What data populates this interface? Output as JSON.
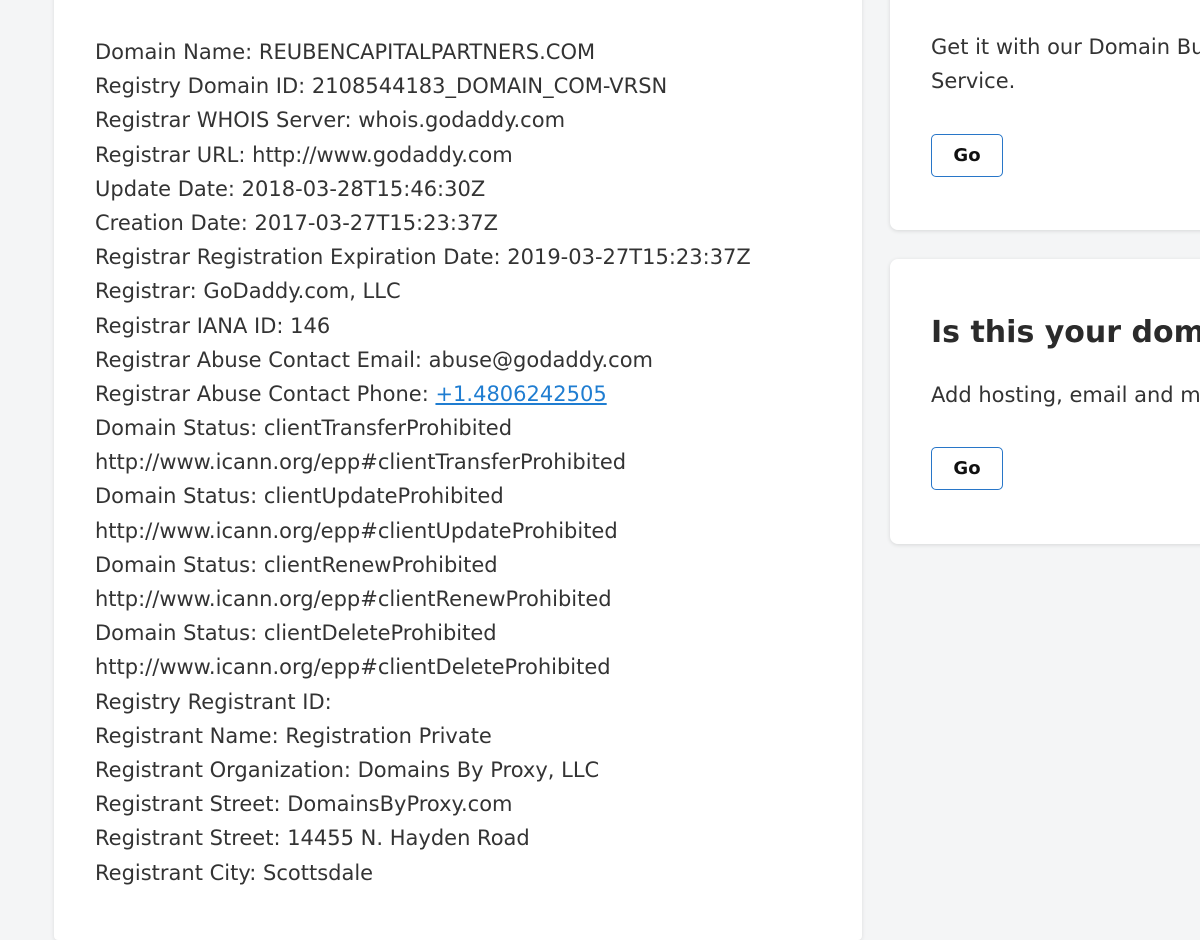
{
  "whois": {
    "lines": [
      "Domain Name: REUBENCAPITALPARTNERS.COM",
      "Registry Domain ID: 2108544183_DOMAIN_COM-VRSN",
      "Registrar WHOIS Server: whois.godaddy.com",
      "Registrar URL: http://www.godaddy.com",
      "Update Date: 2018-03-28T15:46:30Z",
      "Creation Date: 2017-03-27T15:23:37Z",
      "Registrar Registration Expiration Date: 2019-03-27T15:23:37Z",
      "Registrar: GoDaddy.com, LLC",
      "Registrar IANA ID: 146",
      "Registrar Abuse Contact Email: abuse@godaddy.com",
      "Registrar Abuse Contact Phone: ",
      "Domain Status: clientTransferProhibited",
      "http://www.icann.org/epp#clientTransferProhibited",
      "Domain Status: clientUpdateProhibited",
      "http://www.icann.org/epp#clientUpdateProhibited",
      "Domain Status: clientRenewProhibited",
      "http://www.icann.org/epp#clientRenewProhibited",
      "Domain Status: clientDeleteProhibited",
      "http://www.icann.org/epp#clientDeleteProhibited",
      "Registry Registrant ID:",
      "Registrant Name: Registration Private",
      "Registrant Organization: Domains By Proxy, LLC",
      "Registrant Street: DomainsByProxy.com",
      "Registrant Street: 14455 N. Hayden Road",
      "Registrant City: Scottsdale"
    ],
    "abuse_phone": "+1.4806242505"
  },
  "buy_card": {
    "text_line1": "Get it with our Domain Buy",
    "text_line2": "Service.",
    "button_label": "Go"
  },
  "owner_card": {
    "heading": "Is this your domain",
    "text": "Add hosting, email and mo",
    "button_label": "Go"
  },
  "colors": {
    "link": "#1f7dd1",
    "button_border": "#2876c8",
    "background": "#f4f5f6"
  }
}
